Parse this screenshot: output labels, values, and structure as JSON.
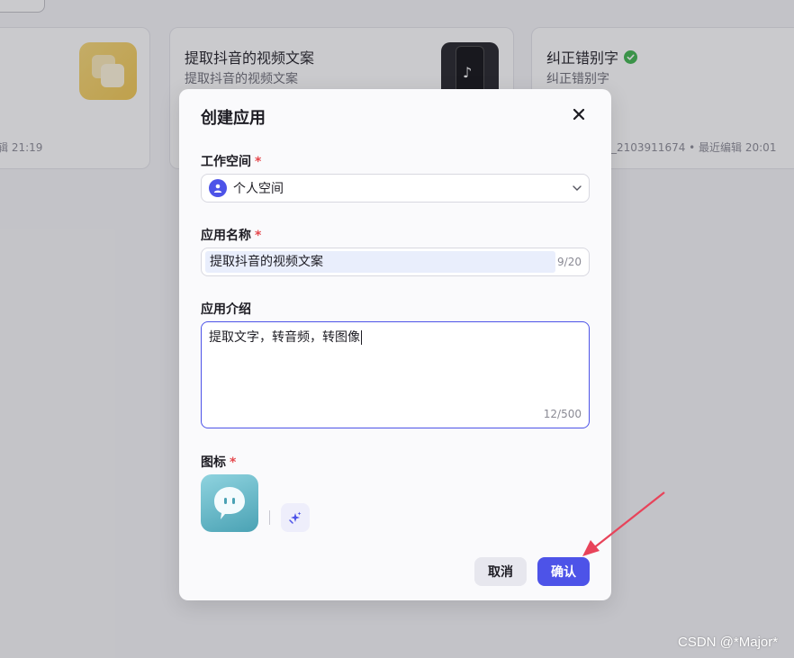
{
  "background": {
    "cards": [
      {
        "title": "",
        "desc": "",
        "meta": "辑 21:19"
      },
      {
        "title": "提取抖音的视频文案",
        "desc": "提取抖音的视频文案",
        "meta": ""
      },
      {
        "title": "纠正错别字",
        "desc": "纠正错别字",
        "meta": "_2103911674 • 最近编辑 20:01",
        "verified_icon": "check-circle-icon"
      }
    ]
  },
  "modal": {
    "title": "创建应用",
    "close_icon": "close-icon",
    "workspace": {
      "label": "工作空间",
      "required": "*",
      "value": "个人空间",
      "icon": "person-icon"
    },
    "app_name": {
      "label": "应用名称",
      "required": "*",
      "value": "提取抖音的视频文案",
      "counter": "9/20"
    },
    "app_desc": {
      "label": "应用介绍",
      "value": "提取文字，转音频，转图像",
      "counter": "12/500"
    },
    "icon_field": {
      "label": "图标",
      "required": "*",
      "ai_icon": "sparkle-icon"
    },
    "buttons": {
      "cancel": "取消",
      "confirm": "确认"
    }
  },
  "colors": {
    "primary": "#4d53e8",
    "required": "#e5484d",
    "annotation_arrow": "#e8435a"
  },
  "watermark": "CSDN @*Major*"
}
